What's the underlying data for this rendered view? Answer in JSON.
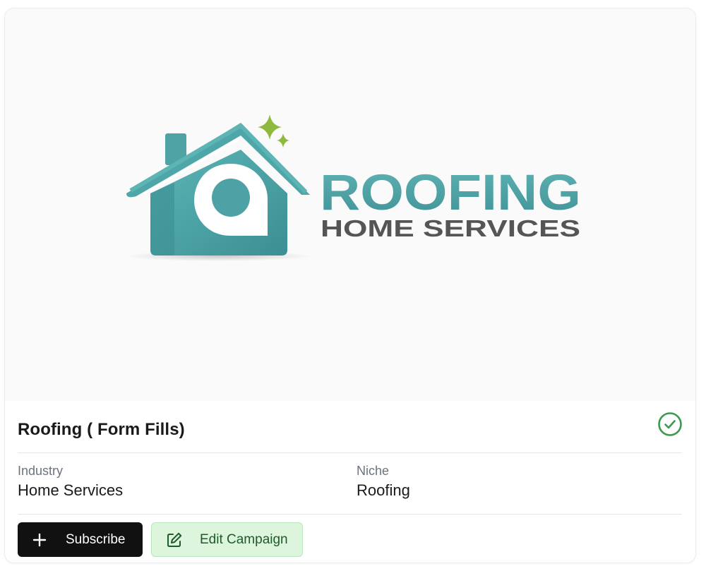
{
  "banner": {
    "logo_title": "ROOFING",
    "logo_subtitle": "HOME SERVICES"
  },
  "campaign": {
    "title": "Roofing ( Form Fills)",
    "status_icon": "check-circle-icon",
    "fields": {
      "industry_label": "Industry",
      "industry_value": "Home Services",
      "niche_label": "Niche",
      "niche_value": "Roofing"
    }
  },
  "actions": {
    "subscribe_label": "Subscribe",
    "subscribe_icon": "plus-icon",
    "edit_label": "Edit Campaign",
    "edit_icon": "edit-icon"
  },
  "colors": {
    "logo_teal": "#4fa6a8",
    "logo_gray": "#555555",
    "sparkle_green": "#8fb83f",
    "status_green": "#3c9a4f",
    "subscribe_bg": "#111111",
    "edit_bg": "#dcf5dc"
  }
}
